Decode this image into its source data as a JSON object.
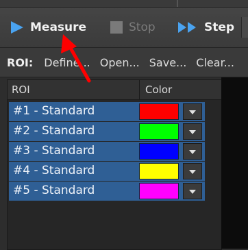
{
  "toolbar": {
    "measure_label": "Measure",
    "stop_label": "Stop",
    "step_label": "Step"
  },
  "roi_bar": {
    "label": "ROI:",
    "define": "Define...",
    "open": "Open...",
    "save": "Save...",
    "clear": "Clear..."
  },
  "table": {
    "col_roi": "ROI",
    "col_color": "Color",
    "rows": [
      {
        "name": "#1 - Standard",
        "color": "#ff0000"
      },
      {
        "name": "#2 - Standard",
        "color": "#00ff00"
      },
      {
        "name": "#3 - Standard",
        "color": "#0000ff"
      },
      {
        "name": "#4 - Standard",
        "color": "#ffff00"
      },
      {
        "name": "#5 - Standard",
        "color": "#ff00ff"
      }
    ]
  },
  "colors": {
    "accent_blue": "#4aa3f0",
    "selection": "#2f5f95",
    "annotation_arrow": "#ff0000"
  }
}
